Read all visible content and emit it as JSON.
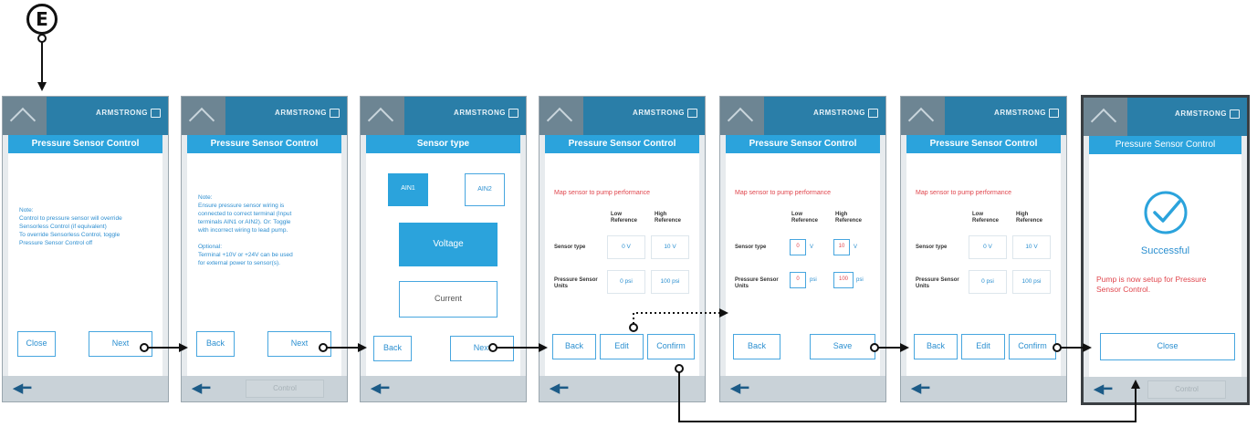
{
  "marker": "E",
  "brand": {
    "logo": "ARMSTRONG"
  },
  "bottom_bar": {
    "back_arrow": "left-arrow-icon",
    "control_label": "Control"
  },
  "screens": [
    {
      "title": "Pressure Sensor Control",
      "note": [
        "Note:",
        "Control to pressure sensor will override",
        "Sensorless Control (if equivalent)",
        "To override Sensorless Control, toggle",
        "Pressure Sensor Control off"
      ],
      "buttons": [
        "Close",
        "Next"
      ]
    },
    {
      "title": "Pressure Sensor Control",
      "note": [
        "Note:",
        "Ensure pressure sensor wiring is",
        "connected to correct terminal (Input",
        "terminals AIN1 or AIN2). Or: Toggle",
        "with incorrect wiring to lead pump.",
        "",
        "Optional:",
        "Terminal +10V or +24V can be used",
        "for external power to sensor(s)."
      ],
      "buttons": [
        "Back",
        "Next"
      ]
    },
    {
      "title": "Sensor type",
      "inputs": [
        "AIN1",
        "AIN2"
      ],
      "options": [
        "Voltage",
        "Current"
      ],
      "buttons": [
        "Back",
        "Next"
      ]
    },
    {
      "title": "Pressure Sensor Control",
      "heading": "Map sensor to pump performance",
      "columns": [
        "Low Reference",
        "High Reference"
      ],
      "rows": [
        {
          "label": "Sensor type",
          "low": "0 V",
          "high": "10 V"
        },
        {
          "label": "Pressure Sensor Units",
          "low": "0 psi",
          "high": "100 psi"
        }
      ],
      "buttons": [
        "Back",
        "Edit",
        "Confirm"
      ]
    },
    {
      "title": "Pressure Sensor Control",
      "heading": "Map sensor to pump performance",
      "columns": [
        "Low Reference",
        "High Reference"
      ],
      "rows": [
        {
          "label": "Sensor type",
          "low": "0",
          "low_unit": "V",
          "high": "10",
          "high_unit": "V"
        },
        {
          "label": "Pressure Sensor Units",
          "low": "0",
          "low_unit": "psi",
          "high": "100",
          "high_unit": "psi"
        }
      ],
      "buttons": [
        "Back",
        "Save"
      ]
    },
    {
      "title": "Pressure Sensor Control",
      "heading": "Map sensor to pump performance",
      "columns": [
        "Low Reference",
        "High Reference"
      ],
      "rows": [
        {
          "label": "Sensor type",
          "low": "0 V",
          "high": "10 V"
        },
        {
          "label": "Pressure Sensor Units",
          "low": "0 psi",
          "high": "100 psi"
        }
      ],
      "buttons": [
        "Back",
        "Edit",
        "Confirm"
      ]
    },
    {
      "title": "Pressure Sensor Control",
      "status": "Successful",
      "message": "Pump is now setup for Pressure Sensor Control.",
      "buttons": [
        "Close"
      ]
    }
  ]
}
